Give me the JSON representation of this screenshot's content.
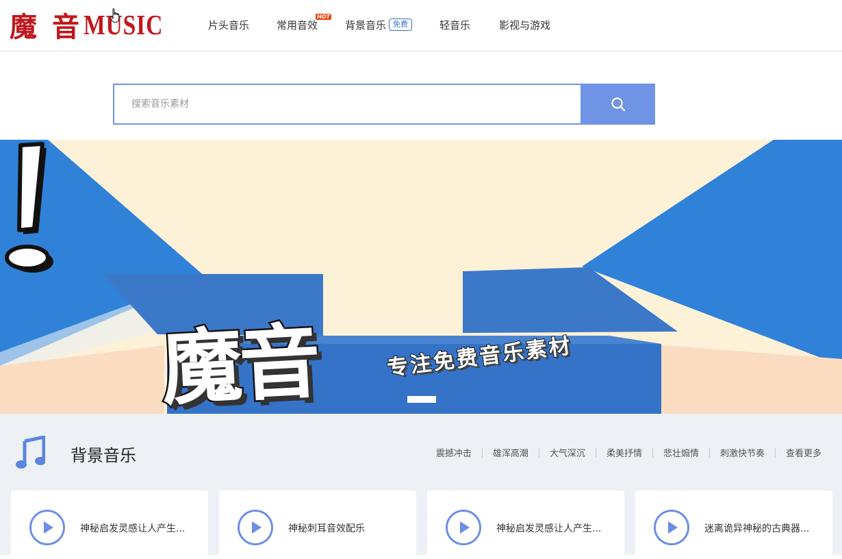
{
  "header": {
    "logo_cn": "魔 音",
    "logo_en": "MUSIC",
    "nav": [
      {
        "label": "片头音乐"
      },
      {
        "label": "常用音效",
        "badge": "HOT"
      },
      {
        "label": "背景音乐",
        "badge": "免费"
      },
      {
        "label": "轻音乐"
      },
      {
        "label": "影视与游戏"
      }
    ]
  },
  "search": {
    "placeholder": "搜索音乐素材",
    "icon": "search-icon"
  },
  "banner": {
    "title": "魔音",
    "subtitle": "专注免费音乐素材",
    "exclaim": "!"
  },
  "section": {
    "icon": "music-note-icon",
    "title": "背景音乐",
    "tags": [
      "震撼冲击",
      "雄浑高潮",
      "大气深沉",
      "柔美抒情",
      "悲壮煽情",
      "刺激快节奏",
      "查看更多"
    ]
  },
  "cards": [
    {
      "title": "神秘启发灵感让人产生..."
    },
    {
      "title": "神秘刺耳音效配乐"
    },
    {
      "title": "神秘启发灵感让人产生..."
    },
    {
      "title": "迷离诡异神秘的古典器..."
    }
  ],
  "colors": {
    "brand_red": "#c4161c",
    "accent_blue": "#6f94e6",
    "banner_blue": "#2f7fd6"
  }
}
